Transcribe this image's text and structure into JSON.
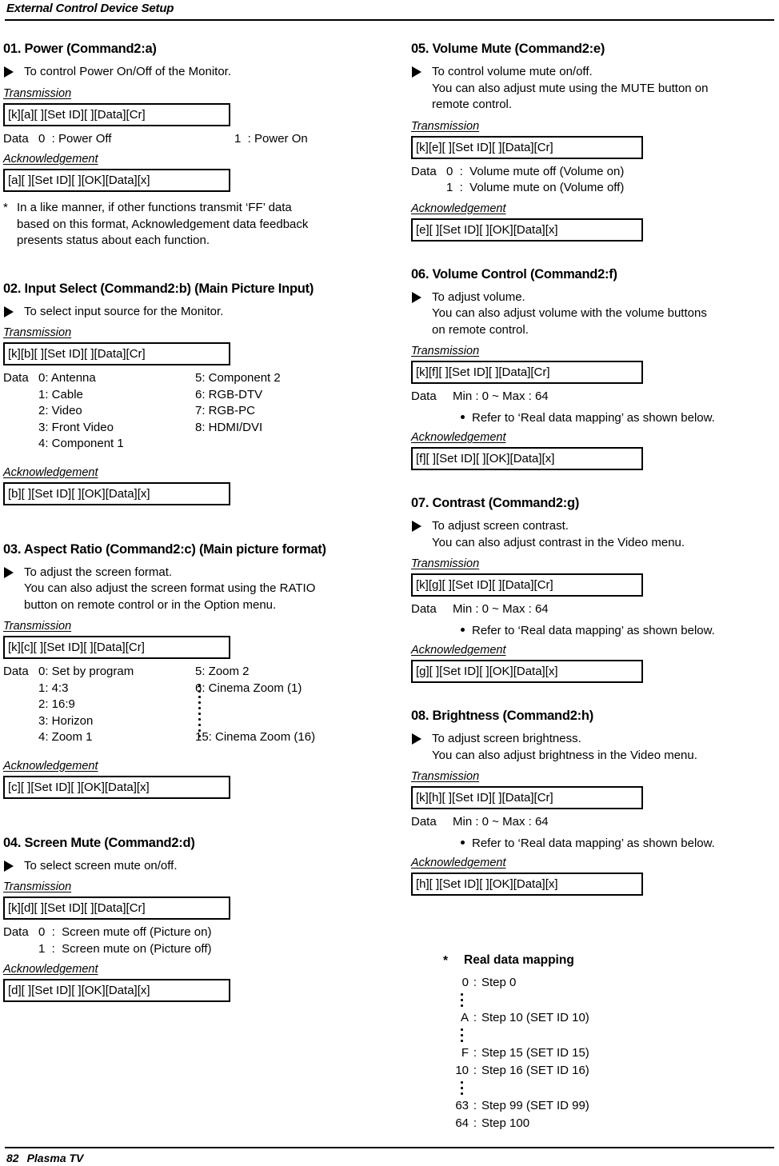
{
  "header": {
    "running_head": "External Control Device Setup"
  },
  "footer": {
    "page_number": "82",
    "label": "Plasma TV"
  },
  "labels": {
    "transmission": "Transmission",
    "acknowledgement": "Acknowledgement",
    "data": "Data",
    "refer_note": "Refer to ‘Real data mapping’ as shown below.",
    "min_max": "Min : 0 ~ Max : 64"
  },
  "sections": [
    {
      "id": "01",
      "title": "01. Power (Command2:a)",
      "purpose": [
        "To control Power On/Off of the Monitor."
      ],
      "transmission": "[k][a][  ][Set ID][  ][Data][Cr]",
      "data_label": "Data",
      "data_rows": [
        {
          "lead": "Data",
          "col1": "0  : Power Off",
          "col2": "1  : Power On"
        }
      ],
      "acknowledgement": "[a][  ][Set ID][  ][OK][Data][x]",
      "note": [
        "In a like manner, if other functions transmit ‘FF’ data",
        "based on this format, Acknowledgement data feedback",
        "presents status about each function."
      ]
    },
    {
      "id": "02",
      "title": "02. Input Select (Command2:b) (Main Picture Input)",
      "purpose": [
        "To select input source for the Monitor."
      ],
      "transmission": "[k][b][  ][Set ID][  ][Data][Cr]",
      "options": [
        {
          "lead": "Data",
          "c1": "0: Antenna",
          "c2": "5: Component 2"
        },
        {
          "lead": "",
          "c1": "1: Cable",
          "c2": "6: RGB-DTV"
        },
        {
          "lead": "",
          "c1": "2: Video",
          "c2": "7: RGB-PC"
        },
        {
          "lead": "",
          "c1": "3: Front Video",
          "c2": "8: HDMI/DVI"
        },
        {
          "lead": "",
          "c1": "4: Component 1",
          "c2": ""
        }
      ],
      "acknowledgement": "[b][  ][Set ID][  ][OK][Data][x]"
    },
    {
      "id": "03",
      "title": "03. Aspect Ratio (Command2:c) (Main picture format)",
      "purpose": [
        "To adjust the screen format.",
        "You can also adjust the screen format using the RATIO",
        "button on remote control or in the Option menu."
      ],
      "transmission": "[k][c][  ][Set ID][  ][Data][Cr]",
      "options": [
        {
          "lead": "Data",
          "c1": "0: Set by program",
          "c2": "5: Zoom 2"
        },
        {
          "lead": "",
          "c1": "1: 4:3",
          "c2": "6: Cinema Zoom (1)"
        },
        {
          "lead": "",
          "c1": "2: 16:9",
          "c2": ""
        },
        {
          "lead": "",
          "c1": "3: Horizon",
          "c2": ""
        },
        {
          "lead": "",
          "c1": "4: Zoom 1",
          "c2": "15: Cinema Zoom (16)"
        }
      ],
      "acknowledgement": "[c][  ][Set ID][  ][OK][Data][x]"
    },
    {
      "id": "04",
      "title": "04. Screen Mute (Command2:d)",
      "purpose": [
        "To select screen mute on/off."
      ],
      "transmission": "[k][d][  ][Set ID][  ][Data][Cr]",
      "data_rows": [
        {
          "lead": "Data",
          "col1": "0  :  Screen mute off (Picture on)",
          "col2": ""
        },
        {
          "lead": "",
          "col1": "1  :  Screen mute on (Picture off)",
          "col2": ""
        }
      ],
      "acknowledgement": "[d][  ][Set ID][  ][OK][Data][x]"
    },
    {
      "id": "05",
      "title": "05. Volume Mute (Command2:e)",
      "purpose": [
        "To control volume mute on/off.",
        "You can also adjust mute using the MUTE button on",
        "remote control."
      ],
      "transmission": "[k][e][  ][Set ID][  ][Data][Cr]",
      "data_rows": [
        {
          "lead": "Data",
          "col1": "0  :  Volume mute off (Volume on)",
          "col2": ""
        },
        {
          "lead": "",
          "col1": "1  :  Volume mute on (Volume off)",
          "col2": ""
        }
      ],
      "acknowledgement": "[e][  ][Set ID][  ][OK][Data][x]"
    },
    {
      "id": "06",
      "title": "06. Volume Control (Command2:f)",
      "purpose": [
        "To adjust volume.",
        "You can also adjust volume with the volume buttons",
        "on remote control."
      ],
      "transmission": "[k][f][  ][Set ID][  ][Data][Cr]",
      "range_row": {
        "lead": "Data",
        "value": "Min : 0 ~ Max : 64"
      },
      "refer": "Refer to ‘Real data mapping’ as shown below.",
      "acknowledgement": "[f][  ][Set ID][  ][OK][Data][x]"
    },
    {
      "id": "07",
      "title": "07. Contrast (Command2:g)",
      "purpose": [
        "To adjust screen contrast.",
        "You can also adjust contrast in the Video menu."
      ],
      "transmission": "[k][g][  ][Set ID][  ][Data][Cr]",
      "range_row": {
        "lead": "Data",
        "value": "Min : 0 ~ Max : 64"
      },
      "refer": "Refer to ‘Real data mapping’ as shown below.",
      "acknowledgement": "[g][  ][Set ID][  ][OK][Data][x]"
    },
    {
      "id": "08",
      "title": "08. Brightness (Command2:h)",
      "purpose": [
        "To adjust screen brightness.",
        "You can also adjust brightness in the Video menu."
      ],
      "transmission": "[k][h][  ][Set ID][  ][Data][Cr]",
      "range_row": {
        "lead": "Data",
        "value": "Min : 0 ~ Max : 64"
      },
      "refer": "Refer to ‘Real data mapping’ as shown below.",
      "acknowledgement": "[h][  ][Set ID][  ][OK][Data][x]"
    }
  ],
  "real_data_mapping": {
    "star": "*",
    "title": "Real data mapping",
    "rows": [
      {
        "key": "0",
        "sep": ":",
        "value": "Step 0"
      },
      {
        "ellipsis": true
      },
      {
        "key": "A",
        "sep": ":",
        "value": "Step 10 (SET ID 10)"
      },
      {
        "ellipsis": true
      },
      {
        "key": "F",
        "sep": ":",
        "value": "Step 15 (SET ID 15)"
      },
      {
        "key": "10",
        "sep": ":",
        "value": "Step 16 (SET ID 16)"
      },
      {
        "ellipsis": true
      },
      {
        "key": "63",
        "sep": ":",
        "value": "Step 99 (SET ID 99)"
      },
      {
        "key": "64",
        "sep": ":",
        "value": "Step 100"
      }
    ]
  }
}
